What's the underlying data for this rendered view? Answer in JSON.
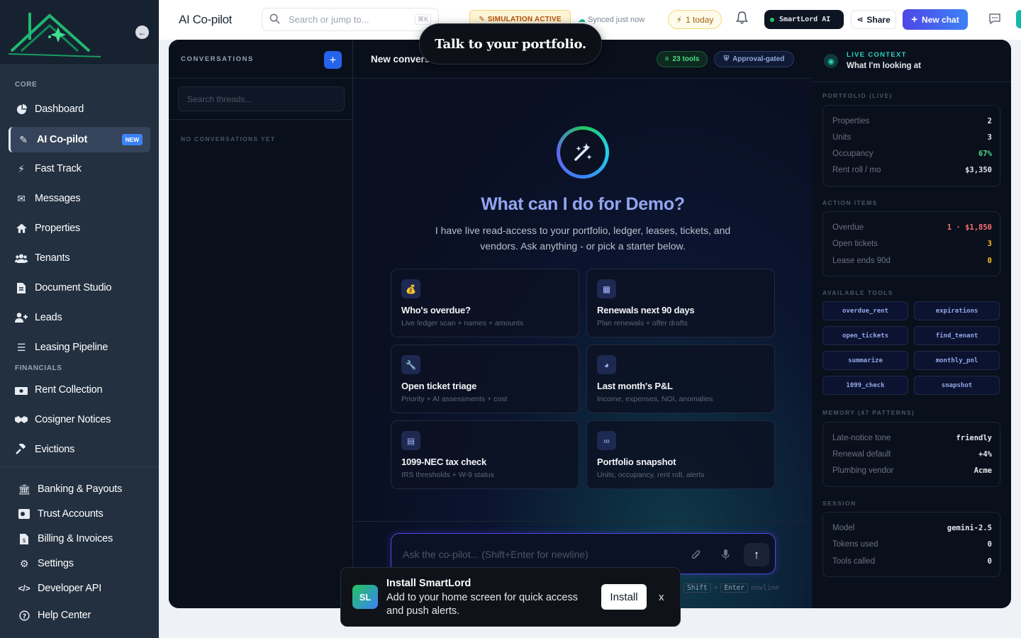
{
  "sidebar": {
    "core_label": "CORE",
    "financials_label": "FINANCIALS",
    "new_badge": "NEW",
    "items": [
      {
        "label": "Dashboard",
        "icon": "pie-chart-icon"
      },
      {
        "label": "AI Co-pilot",
        "icon": "magic-wand-icon"
      },
      {
        "label": "Fast Track",
        "icon": "lightning-icon"
      },
      {
        "label": "Messages",
        "icon": "envelope-icon"
      },
      {
        "label": "Properties",
        "icon": "home-icon"
      },
      {
        "label": "Tenants",
        "icon": "users-icon"
      },
      {
        "label": "Document Studio",
        "icon": "file-icon"
      },
      {
        "label": "Leads",
        "icon": "user-plus-icon"
      },
      {
        "label": "Leasing Pipeline",
        "icon": "list-icon"
      },
      {
        "label": "Rent Collection",
        "icon": "money-icon"
      },
      {
        "label": "Cosigner Notices",
        "icon": "handshake-icon"
      },
      {
        "label": "Evictions",
        "icon": "gavel-icon"
      },
      {
        "label": "Banking & Payouts",
        "icon": "bank-icon"
      },
      {
        "label": "Trust Accounts",
        "icon": "vault-icon"
      },
      {
        "label": "Billing & Invoices",
        "icon": "invoice-icon"
      },
      {
        "label": "Settings",
        "icon": "gear-icon"
      },
      {
        "label": "Developer API",
        "icon": "code-icon"
      },
      {
        "label": "Help Center",
        "icon": "question-icon"
      }
    ]
  },
  "topbar": {
    "title": "AI Co-pilot",
    "search_placeholder": "Search or jump to...",
    "search_shortcut": "⌘K",
    "simulation": "SIMULATION ACTIVE",
    "synced": "Synced just now",
    "today": "1 today",
    "assistant": "SmartLord AI",
    "share": "Share",
    "new_chat": "New chat"
  },
  "tooltip": "Talk to your portfolio.",
  "conversations": {
    "title": "CONVERSATIONS",
    "search_placeholder": "Search threads...",
    "empty": "NO CONVERSATIONS YET"
  },
  "chat": {
    "header": "New conversation",
    "tools_badge": "23 tools",
    "approval_badge": "Approval-gated",
    "hero_title": "What can I do for Demo?",
    "hero_sub": "I have live read-access to your portfolio, ledger, leases, tickets, and vendors. Ask anything - or pick a starter below.",
    "starters": [
      {
        "title": "Who's overdue?",
        "sub": "Live ledger scan + names + amounts",
        "icon": "money-bag-icon"
      },
      {
        "title": "Renewals next 90 days",
        "sub": "Plan renewals + offer drafts",
        "icon": "calendar-icon"
      },
      {
        "title": "Open ticket triage",
        "sub": "Priority + AI assessments + cost",
        "icon": "wrench-icon"
      },
      {
        "title": "Last month's P&L",
        "sub": "Income, expenses, NOI, anomalies",
        "icon": "pie-chart-icon"
      },
      {
        "title": "1099-NEC tax check",
        "sub": "IRS thresholds + W-9 status",
        "icon": "document-icon"
      },
      {
        "title": "Portfolio snapshot",
        "sub": "Units, occupancy, rent roll, alerts",
        "icon": "binoculars-icon"
      }
    ],
    "composer_placeholder": "Ask the co-pilot... (Shift+Enter for newline)",
    "hint_keys": [
      "Shift",
      "Enter"
    ],
    "hint_text": "newline"
  },
  "context": {
    "label": "LIVE CONTEXT",
    "title": "What I'm looking at",
    "portfolio_label": "PORTFOLIO (LIVE)",
    "portfolio": [
      {
        "k": "Properties",
        "v": "2",
        "color": "#e5e7eb"
      },
      {
        "k": "Units",
        "v": "3",
        "color": "#e5e7eb"
      },
      {
        "k": "Occupancy",
        "v": "67%",
        "color": "#4ade80"
      },
      {
        "k": "Rent roll / mo",
        "v": "$3,350",
        "color": "#e5e7eb"
      }
    ],
    "actions_label": "ACTION ITEMS",
    "actions": [
      {
        "k": "Overdue",
        "v": "1 · $1,850",
        "color": "#f87171"
      },
      {
        "k": "Open tickets",
        "v": "3",
        "color": "#fbbf24"
      },
      {
        "k": "Lease ends 90d",
        "v": "0",
        "color": "#fbbf24"
      }
    ],
    "tools_label": "AVAILABLE TOOLS",
    "tools": [
      "overdue_rent",
      "expirations",
      "open_tickets",
      "find_tenant",
      "summarize",
      "monthly_pnl",
      "1099_check",
      "snapshot"
    ],
    "memory_label": "MEMORY (47 PATTERNS)",
    "memory": [
      {
        "k": "Late-notice tone",
        "v": "friendly",
        "color": "#e5e7eb"
      },
      {
        "k": "Renewal default",
        "v": "+4%",
        "color": "#e5e7eb"
      },
      {
        "k": "Plumbing vendor",
        "v": "Acme",
        "color": "#e5e7eb"
      }
    ],
    "session_label": "SESSION",
    "session": [
      {
        "k": "Model",
        "v": "gemini-2.5",
        "color": "#e5e7eb"
      },
      {
        "k": "Tokens used",
        "v": "0",
        "color": "#e5e7eb"
      },
      {
        "k": "Tools called",
        "v": "0",
        "color": "#e5e7eb"
      }
    ]
  },
  "install": {
    "logo": "SL",
    "title": "Install SmartLord",
    "sub": "Add to your home screen for quick access and push alerts.",
    "button": "Install",
    "close": "x"
  }
}
